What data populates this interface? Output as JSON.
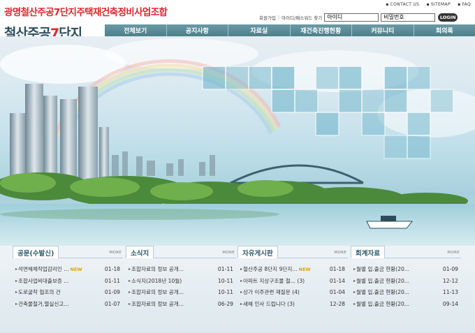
{
  "header": {
    "org_title": "광명철산주공7단지주택재건축정비사업조합",
    "logo_main": "철산주공",
    "logo_accent": "7",
    "logo_tail": "단지",
    "top_links": [
      "CONTACT US",
      "SITEMAP",
      "FAQ"
    ],
    "join_link": "회원가입",
    "find_link": "아이디/패스워드 찾기",
    "id_placeholder": "아이디",
    "pw_placeholder": "비밀번호",
    "login_label": "LOGIN"
  },
  "nav": {
    "items": [
      "전체보기",
      "공지사항",
      "자료실",
      "재건축진행현황",
      "커뮤니티",
      "회의록"
    ]
  },
  "boards": [
    {
      "title": "공문(수발신)",
      "more": "MORE",
      "items": [
        {
          "title": "석면해체작업감리인 ...",
          "new": "NEW",
          "date": "01-18"
        },
        {
          "title": "조합사업비대출보증 ...",
          "new": "",
          "date": "01-11"
        },
        {
          "title": "도로굴착 협조의 건",
          "new": "",
          "date": "01-09"
        },
        {
          "title": "건축물철거,멸실신고...",
          "new": "",
          "date": "01-07"
        }
      ]
    },
    {
      "title": "소식지",
      "more": "MORE",
      "items": [
        {
          "title": "조합자료의 정보 공개...",
          "new": "",
          "date": "01-11"
        },
        {
          "title": "소식지(2018년 10월)",
          "new": "",
          "date": "10-11"
        },
        {
          "title": "조합자료의 정보 공개...",
          "new": "",
          "date": "10-11"
        },
        {
          "title": "조합자료의 정보 공개...",
          "new": "",
          "date": "06-29"
        }
      ]
    },
    {
      "title": "자유게시판",
      "more": "MORE",
      "items": [
        {
          "title": "철산주공 8단지 9단지...",
          "new": "NEW",
          "date": "01-18"
        },
        {
          "title": "아파트 지상구조물 철... (3)",
          "new": "",
          "date": "01-14"
        },
        {
          "title": "상가 이주관련 재질문 (4)",
          "new": "",
          "date": "01-04"
        },
        {
          "title": "새해 인사 드립니다 (3)",
          "new": "",
          "date": "12-28"
        }
      ]
    },
    {
      "title": "회계자료",
      "more": "MORE",
      "items": [
        {
          "title": "월별 입.출금 현황(20...",
          "new": "",
          "date": "01-09"
        },
        {
          "title": "월별 입.출금 현황(20...",
          "new": "",
          "date": "12-12"
        },
        {
          "title": "월별 입.출금 현황(20...",
          "new": "",
          "date": "11-13"
        },
        {
          "title": "월별 입.출금 현황(20...",
          "new": "",
          "date": "09-14"
        }
      ]
    }
  ],
  "colors": {
    "title_red": "#e0262e",
    "logo_teal": "#2c4d5c",
    "nav_bg": "#5a8b97",
    "new_badge": "#e8a000"
  }
}
